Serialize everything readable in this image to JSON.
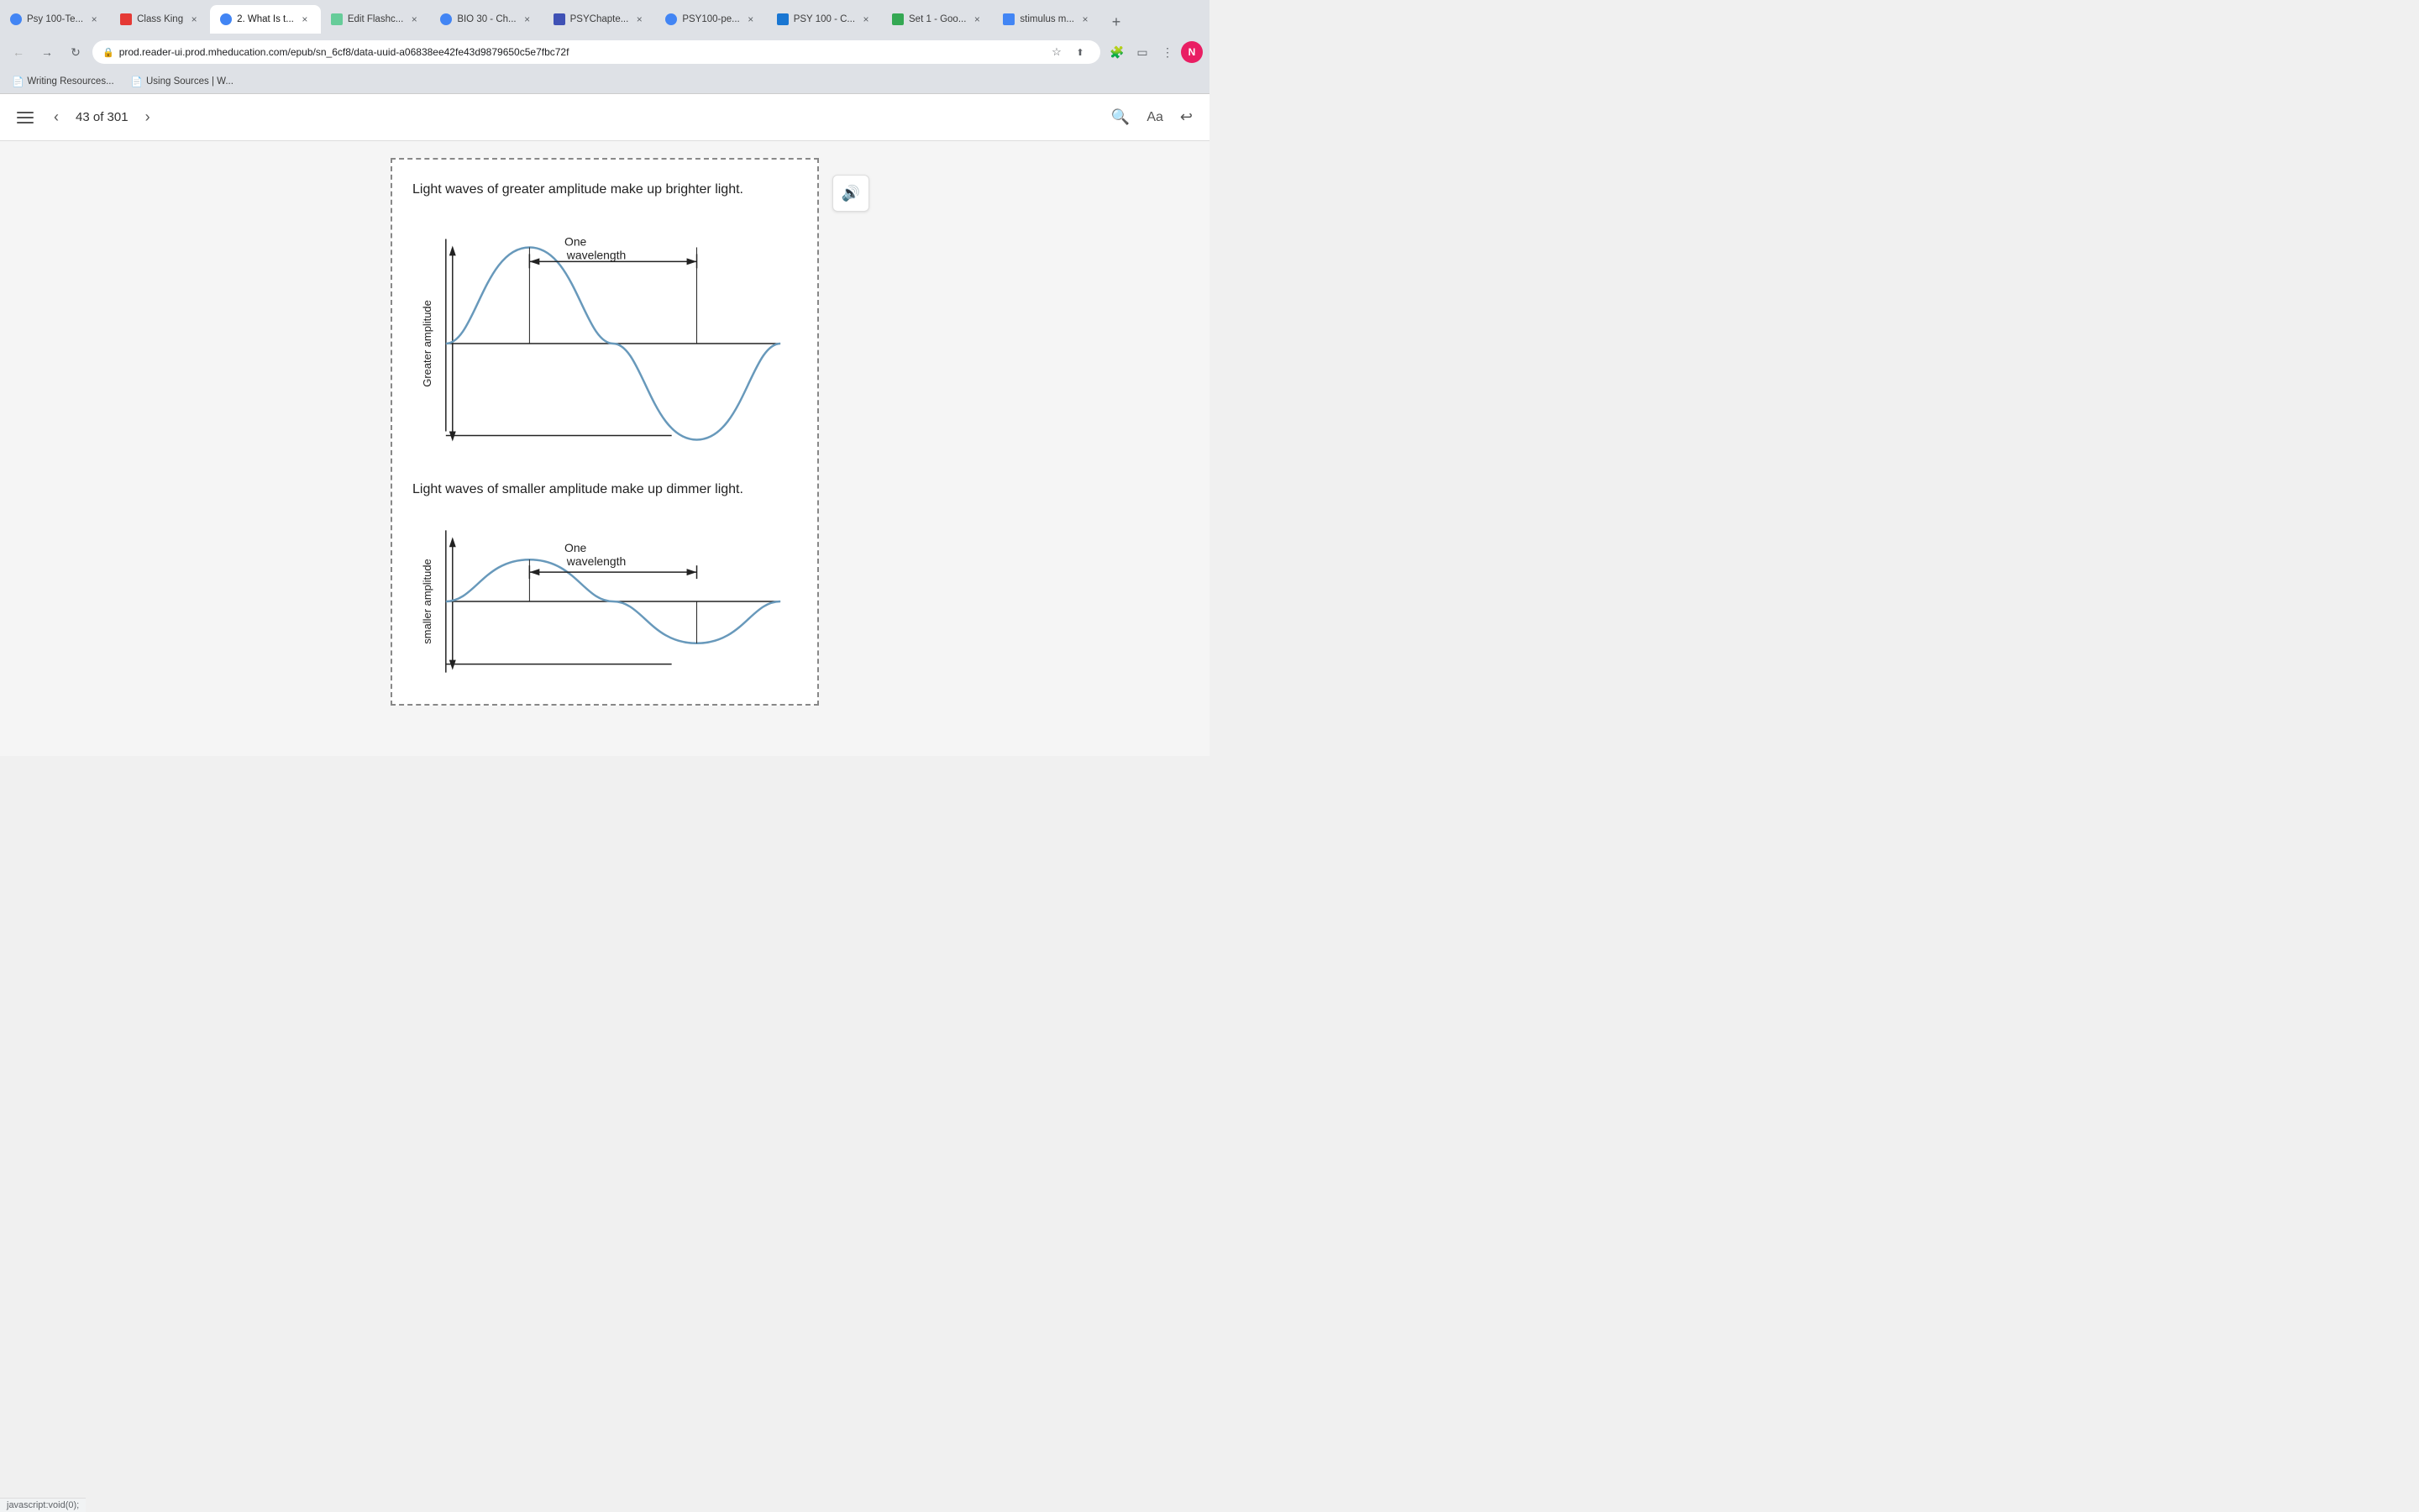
{
  "browser": {
    "tabs": [
      {
        "id": "psy100",
        "label": "Psy 100-Te...",
        "favicon": "psy",
        "active": false
      },
      {
        "id": "classking",
        "label": "Class King",
        "favicon": "classking",
        "active": false
      },
      {
        "id": "reader",
        "label": "2. What Is t...",
        "favicon": "active-tab",
        "active": true
      },
      {
        "id": "editflash",
        "label": "Edit Flashc...",
        "favicon": "edit",
        "active": false
      },
      {
        "id": "bio30",
        "label": "BIO 30 - Ch...",
        "favicon": "bio",
        "active": false
      },
      {
        "id": "psychapter",
        "label": "PSYChapte...",
        "favicon": "psych",
        "active": false
      },
      {
        "id": "psy100pe",
        "label": "PSY100-pe...",
        "favicon": "psy100",
        "active": false
      },
      {
        "id": "psy100c",
        "label": "PSY 100 - C...",
        "favicon": "psy100c",
        "active": false
      },
      {
        "id": "set1",
        "label": "Set 1 - Goo...",
        "favicon": "set1",
        "active": false
      },
      {
        "id": "stimulus",
        "label": "stimulus m...",
        "favicon": "stimulus",
        "active": false
      }
    ],
    "url": "prod.reader-ui.prod.mheducation.com/epub/sn_6cf8/data-uuid-a06838ee42fe43d9879650c5e7fbc72f",
    "bookmarks": [
      {
        "label": "Writing Resources...",
        "icon": "📄"
      },
      {
        "label": "Using Sources | W...",
        "icon": "📄"
      }
    ]
  },
  "reader": {
    "page_current": "43",
    "page_total": "301",
    "page_display": "43 of 301"
  },
  "content": {
    "section1_text": "Light waves of greater amplitude make up brighter light.",
    "section1_label": "Greater amplitude",
    "wavelength_label1": "One wavelength",
    "section2_text": "Light waves of smaller amplitude make up dimmer light.",
    "section2_label": "smaller amplitude",
    "wavelength_label2": "One wavelength"
  },
  "status": {
    "text": "javascript:void(0);"
  },
  "icons": {
    "toc": "≡",
    "prev": "‹",
    "next": "›",
    "search": "🔍",
    "font": "Aa",
    "back": "↩",
    "audio": "🔊",
    "close": "×",
    "lock": "🔒"
  }
}
